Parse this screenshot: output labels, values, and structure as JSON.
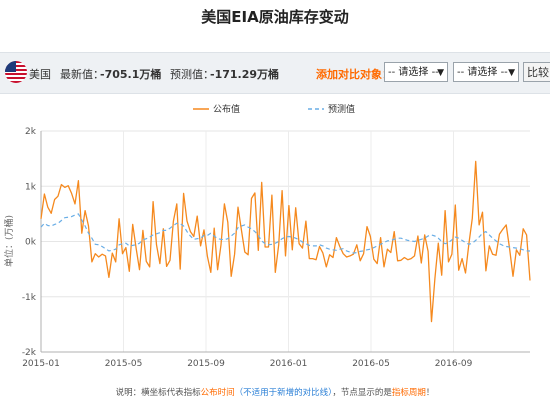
{
  "page": {
    "title": "美国EIA原油库存变动"
  },
  "infobar": {
    "country": "美国",
    "latest_label": "最新值：",
    "latest_value": "-705.1万桶",
    "forecast_label": "预测值：",
    "forecast_value": "-171.29万桶",
    "add_compare_label": "添加对比对象：",
    "select1": "-- 请选择 --",
    "select2": "-- 请选择 --",
    "compare_button": "比较"
  },
  "colors": {
    "published": "#f5891e",
    "forecast": "#6aaee6",
    "accent": "#ff6a00"
  },
  "chart_data": {
    "type": "line",
    "title": "",
    "ylabel": "单位：(万桶)",
    "ylim": [
      -2000,
      2000
    ],
    "yticks": [
      "2k",
      "1k",
      "0k",
      "-1k",
      "-2k"
    ],
    "yticks_values": [
      2000,
      1000,
      0,
      -1000,
      -2000
    ],
    "xticks": [
      "2015-01",
      "2015-05",
      "2015-09",
      "2016-01",
      "2016-05",
      "2016-09"
    ],
    "grid": true,
    "legend_position": "top",
    "series": [
      {
        "name": "公布值",
        "style": "solid",
        "values": [
          410,
          860,
          620,
          510,
          760,
          820,
          1030,
          980,
          1010,
          870,
          680,
          1100,
          150,
          560,
          280,
          -370,
          -220,
          -280,
          -230,
          -260,
          -650,
          -210,
          -370,
          410,
          -220,
          -110,
          -540,
          310,
          -120,
          -510,
          200,
          -360,
          -460,
          720,
          -60,
          -400,
          230,
          -450,
          -340,
          370,
          680,
          -500,
          870,
          370,
          180,
          90,
          460,
          -80,
          210,
          -270,
          -560,
          240,
          -510,
          -60,
          680,
          350,
          -630,
          -230,
          620,
          210,
          -190,
          -240,
          780,
          880,
          -160,
          1070,
          -100,
          -100,
          840,
          -560,
          -60,
          920,
          -260,
          650,
          -150,
          610,
          -40,
          -120,
          370,
          -310,
          -310,
          -330,
          -90,
          -210,
          -460,
          -240,
          -290,
          70,
          -90,
          -220,
          -280,
          -260,
          -230,
          -60,
          -350,
          -220,
          270,
          90,
          -320,
          -400,
          70,
          -460,
          -140,
          -200,
          180,
          -350,
          -340,
          -290,
          -330,
          -310,
          -260,
          100,
          -390,
          120,
          -180,
          -1450,
          -670,
          -30,
          -610,
          560,
          -370,
          -230,
          660,
          -520,
          -310,
          -570,
          -40,
          420,
          1450,
          300,
          530,
          -530,
          -80,
          -230,
          -250,
          130,
          220,
          300,
          -130,
          -630,
          -150,
          -250,
          230,
          120,
          -705.1
        ]
      },
      {
        "name": "预测值",
        "style": "dashed",
        "values": [
          260,
          330,
          290,
          280,
          310,
          330,
          380,
          430,
          440,
          450,
          480,
          500,
          390,
          280,
          150,
          60,
          -50,
          -60,
          -90,
          -130,
          -170,
          -160,
          -140,
          -60,
          -40,
          -30,
          -80,
          -70,
          -60,
          -30,
          30,
          50,
          80,
          120,
          140,
          160,
          200,
          200,
          240,
          290,
          330,
          320,
          280,
          180,
          100,
          40,
          50,
          60,
          110,
          110,
          150,
          100,
          50,
          40,
          30,
          50,
          100,
          150,
          250,
          280,
          300,
          260,
          230,
          180,
          110,
          10,
          -40,
          -60,
          -50,
          -30,
          0,
          50,
          80,
          90,
          80,
          60,
          30,
          -10,
          -40,
          -70,
          -80,
          -80,
          -60,
          -80,
          -120,
          -140,
          -150,
          -160,
          -140,
          -130,
          -170,
          -190,
          -210,
          -200,
          -180,
          -170,
          -150,
          -140,
          -110,
          -80,
          -50,
          -20,
          10,
          20,
          40,
          60,
          60,
          40,
          20,
          10,
          0,
          20,
          40,
          60,
          100,
          120,
          100,
          60,
          0,
          -40,
          -20,
          30,
          80,
          60,
          20,
          -20,
          -50,
          -30,
          20,
          80,
          150,
          180,
          120,
          60,
          10,
          -40,
          -70,
          -90,
          -100,
          -110,
          -120,
          -130,
          -150,
          -170,
          -171.29
        ]
      }
    ]
  },
  "footnote": {
    "prefix": "说明：横坐标代表指标",
    "part1": "公布时间",
    "part2": "（不适用于新增的对比线）",
    "part3": "，节点显示的是",
    "part4": "指标周期",
    "suffix": "！"
  }
}
